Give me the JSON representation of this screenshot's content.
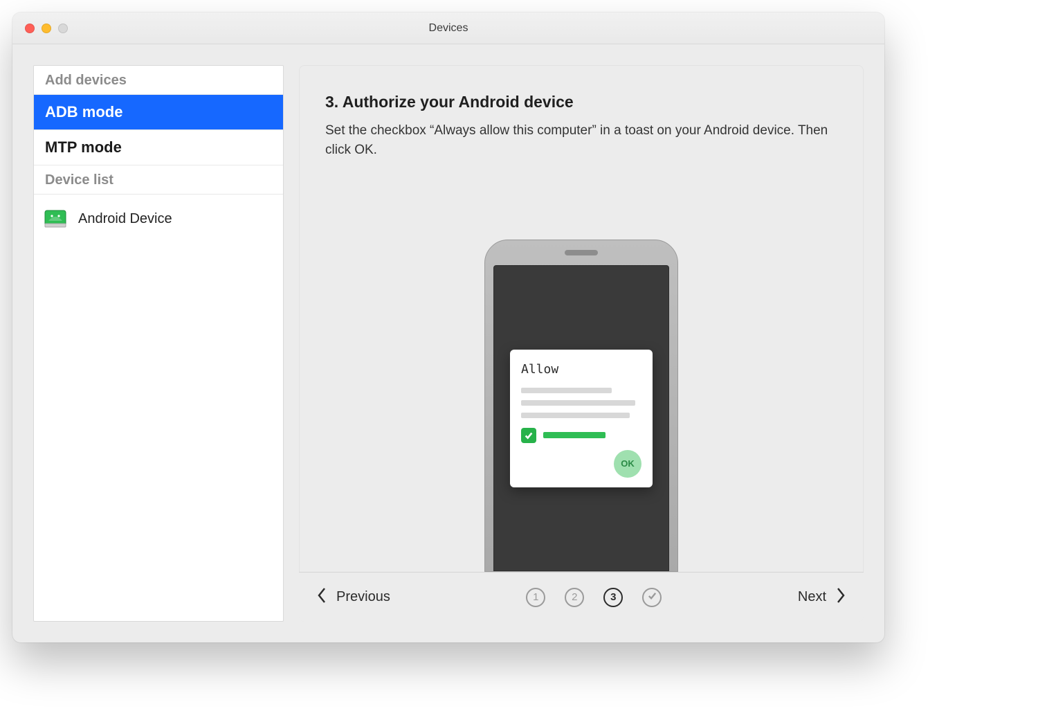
{
  "window": {
    "title": "Devices"
  },
  "sidebar": {
    "header_add": "Add devices",
    "item_adb": "ADB mode",
    "item_mtp": "MTP mode",
    "header_list": "Device list",
    "device0": "Android Device"
  },
  "main": {
    "title": "3. Authorize your Android device",
    "text": "Set the checkbox “Always allow this computer” in a toast on your Android device. Then click OK.",
    "toast_title": "Allow",
    "ok_label": "OK"
  },
  "footer": {
    "previous": "Previous",
    "next": "Next",
    "step1": "1",
    "step2": "2",
    "step3": "3"
  },
  "colors": {
    "accent": "#1668ff",
    "success": "#27b24a"
  }
}
